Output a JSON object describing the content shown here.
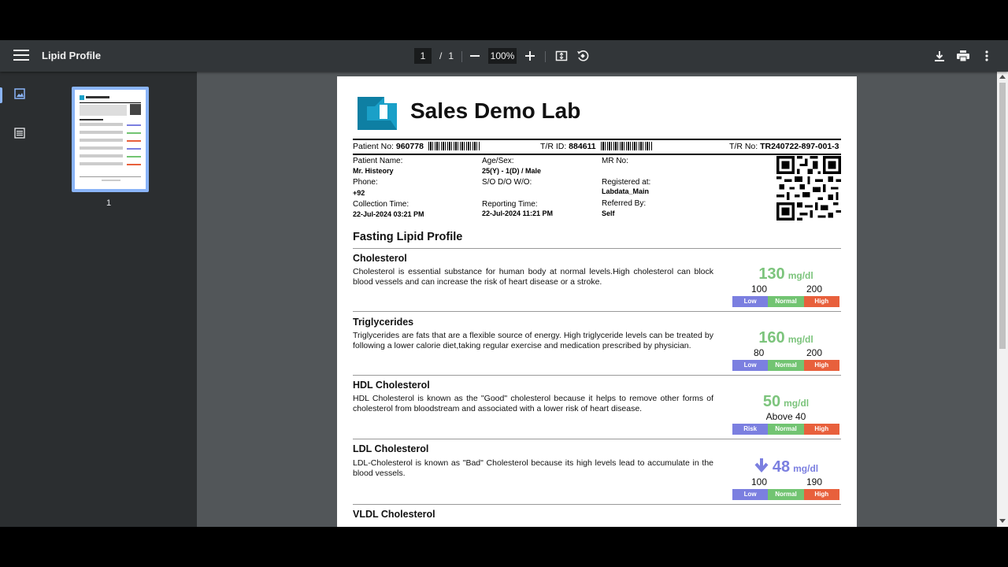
{
  "toolbar": {
    "title": "Lipid Profile",
    "page_current": "1",
    "page_sep": "/",
    "page_total": "1",
    "zoom": "100%"
  },
  "sidebar": {
    "thumb_page_label": "1"
  },
  "report": {
    "lab_name": "Sales Demo Lab",
    "patient_no_label": "Patient No:",
    "patient_no": "960778",
    "tr_id_label": "T/R ID:",
    "tr_id": "884611",
    "tr_no_label": "T/R No:",
    "tr_no": "TR240722-897-001-3",
    "fields": {
      "patient_name_label": "Patient Name:",
      "patient_name": "Mr. Histeory",
      "age_sex_label": "Age/Sex:",
      "age_sex": "25(Y) - 1(D) / Male",
      "mr_no_label": "MR No:",
      "phone_label": "Phone:",
      "phone": "+92",
      "sdo_label": "S/O D/O W/O:",
      "registered_label": "Registered at:",
      "registered": "Labdata_Main",
      "collection_label": "Collection Time:",
      "collection": "22-Jul-2024 03:21 PM",
      "reporting_label": "Reporting Time:",
      "reporting": "22-Jul-2024 11:21 PM",
      "referred_label": "Referred By:",
      "referred": "Self"
    },
    "section_title": "Fasting Lipid Profile",
    "tests": [
      {
        "name": "Cholesterol",
        "desc": "Cholesterol is essential substance for human body at normal levels.High cholesterol can block blood vessels and can increase the risk of heart disease or a stroke.",
        "value": "130",
        "unit": "mg/dl",
        "range_lo": "100",
        "range_hi": "200",
        "bar": [
          "Low",
          "Normal",
          "High"
        ]
      },
      {
        "name": "Triglycerides",
        "desc": "Triglycerides are fats that are a flexible source of energy. High triglyceride levels can be treated by following a lower calorie diet,taking regular exercise and medication prescribed by physician.",
        "value": "160",
        "unit": "mg/dl",
        "range_lo": "80",
        "range_hi": "200",
        "bar": [
          "Low",
          "Normal",
          "High"
        ]
      },
      {
        "name": "HDL Cholesterol",
        "desc": "HDL Cholesterol is known as the \"Good\" cholesterol because it helps to remove other forms of cholesterol from bloodstream and associated with a lower risk of heart disease.",
        "value": "50",
        "unit": "mg/dl",
        "range_text": "Above 40",
        "bar": [
          "Risk",
          "Normal",
          "High"
        ]
      },
      {
        "name": "LDL Cholesterol",
        "desc": "LDL-Cholesterol is known as \"Bad\" Cholesterol because its high levels lead to accumulate in the blood vessels.",
        "value": "48",
        "unit": "mg/dl",
        "range_lo": "100",
        "range_hi": "190",
        "bar": [
          "Low",
          "Normal",
          "High"
        ]
      },
      {
        "name": "VLDL Cholesterol"
      }
    ]
  },
  "colors": {
    "normal_value": "#7cc47c",
    "low_value": "#7b7fe0",
    "bar_low": "#7b7fe0",
    "bar_normal": "#72c472",
    "bar_high": "#e8603c"
  }
}
